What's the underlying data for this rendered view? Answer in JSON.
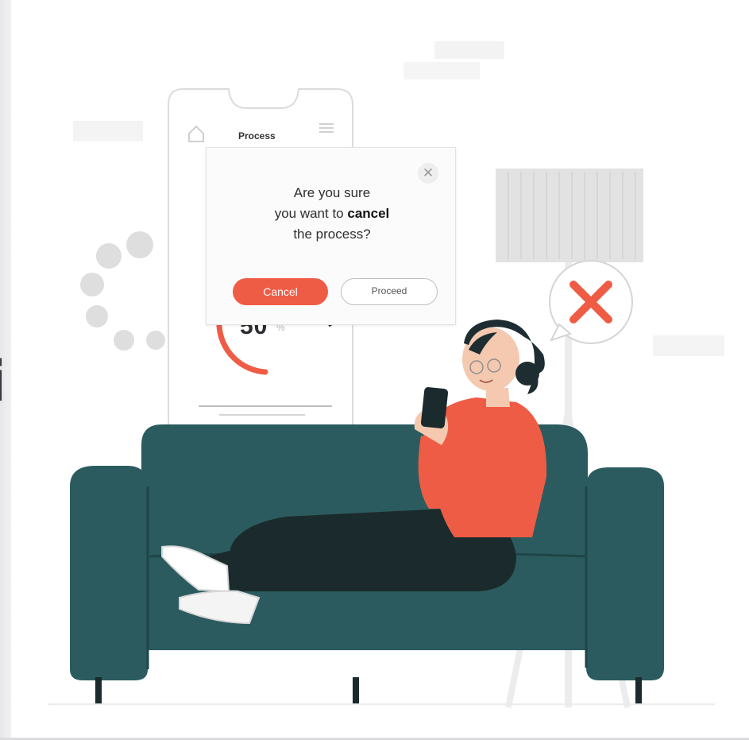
{
  "phone": {
    "title": "Process",
    "progress_value": "50",
    "progress_unit": "%",
    "progress_fraction": 0.5
  },
  "dialog": {
    "line1": "Are you sure",
    "line2_prefix": "you want to ",
    "line2_bold": "cancel",
    "line3": "the process?",
    "cancel_label": "Cancel",
    "proceed_label": "Proceed",
    "close_icon": "✕"
  },
  "error_bubble": {
    "icon": "close-x-icon"
  },
  "colors": {
    "accent": "#ef5c45",
    "sofa": "#2b5b5e",
    "sofa_dark": "#1f4547",
    "pants": "#1b2a2c",
    "hair": "#1e2d31",
    "sweater": "#ef5c45",
    "skin": "#f4c9b0"
  },
  "left_strip": {
    "glyph": "i"
  }
}
